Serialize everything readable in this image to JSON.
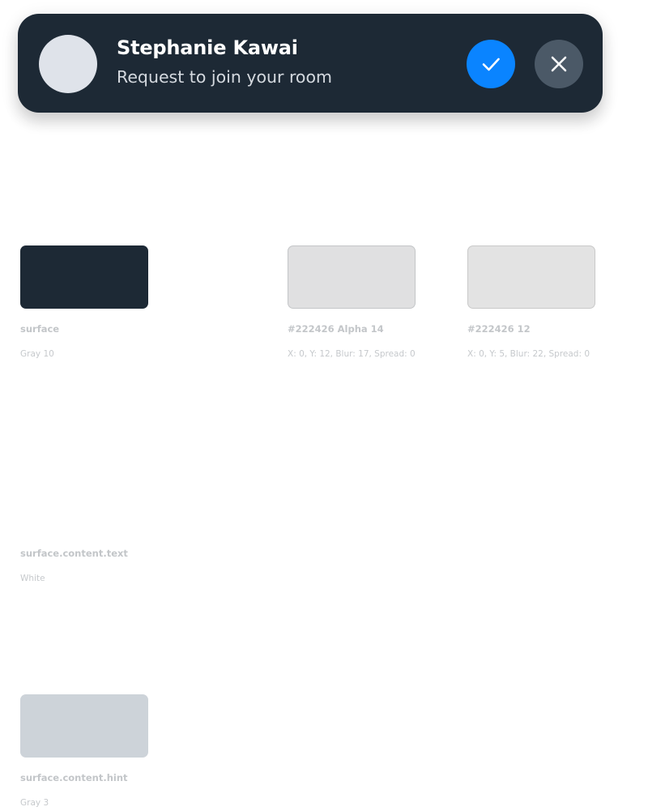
{
  "notification": {
    "name": "Stephanie Kawai",
    "message": "Request to join your room",
    "accept_icon": "check-icon",
    "decline_icon": "close-icon"
  },
  "tokens": [
    {
      "label": "surface",
      "sublabel": "Gray 10",
      "color": "#1d2935"
    },
    {
      "label": "#222426 Alpha 14",
      "sublabel": "X: 0, Y: 12, Blur: 17, Spread: 0"
    },
    {
      "label": "#222426 12",
      "sublabel": "X: 0, Y: 5, Blur: 22, Spread: 0"
    },
    {
      "label": "surface.content.text",
      "sublabel": "White",
      "color": "#ffffff"
    },
    {
      "label": "surface.content.hint",
      "sublabel": "Gray 3",
      "color": "#cdd3d9"
    }
  ],
  "colors": {
    "accept": "#0a84ff",
    "decline": "#4b5967",
    "avatar": "#dfe3ea"
  }
}
